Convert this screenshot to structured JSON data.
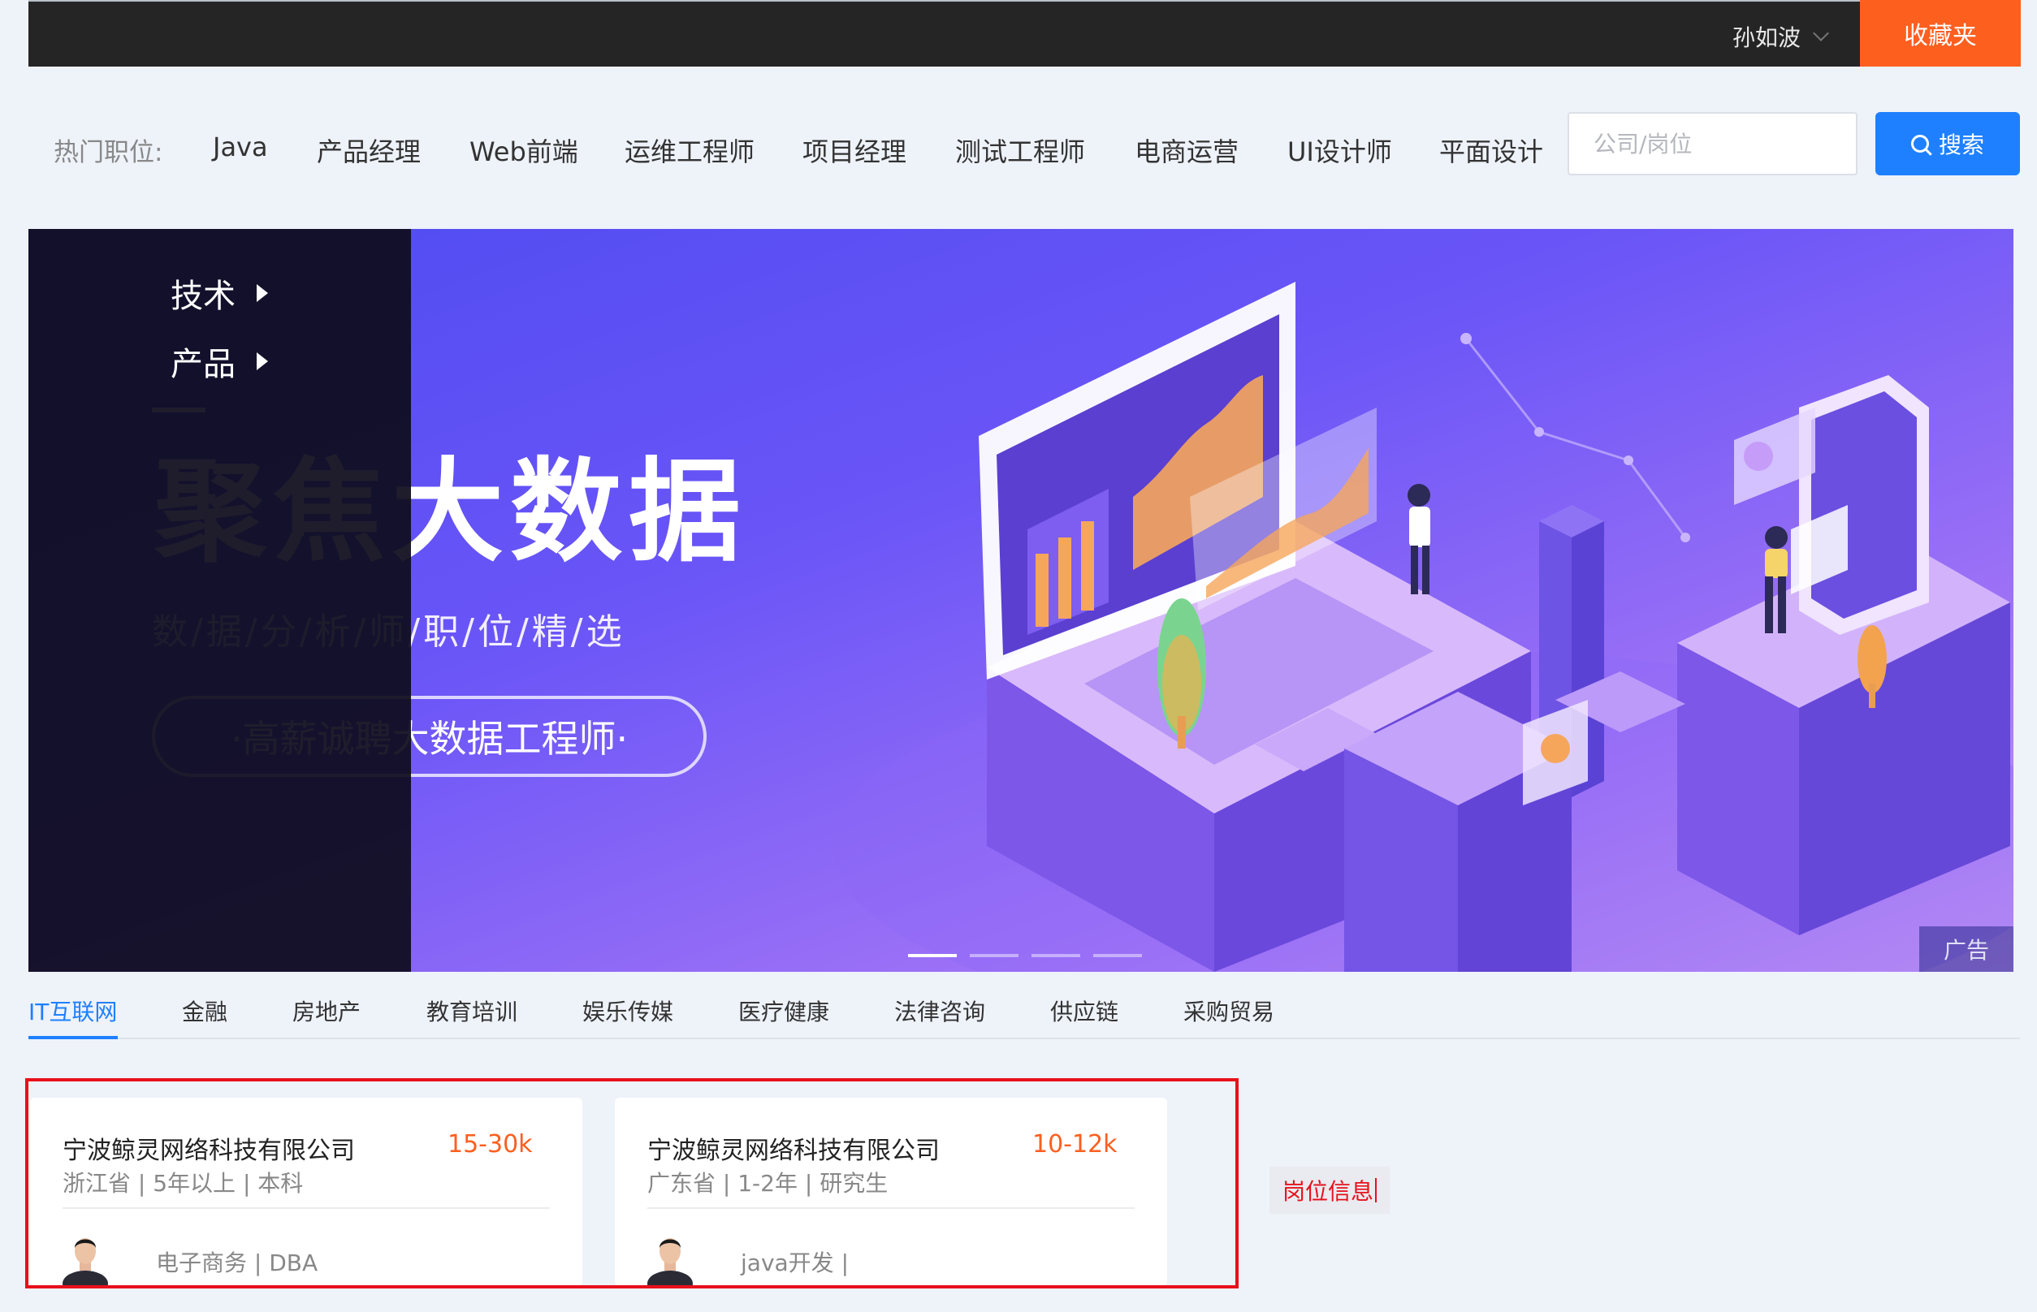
{
  "topbar": {
    "user_name": "孙如波",
    "favorites_label": "收藏夹"
  },
  "hot_jobs": {
    "label": "热门职位:",
    "items": [
      "Java",
      "产品经理",
      "Web前端",
      "运维工程师",
      "项目经理",
      "测试工程师",
      "电商运营",
      "UI设计师",
      "平面设计"
    ]
  },
  "search": {
    "placeholder": "公司/岗位",
    "value": "",
    "button_label": "搜索"
  },
  "category_menu": {
    "items": [
      "技术",
      "产品"
    ]
  },
  "banner": {
    "headline": "聚焦大数据",
    "subtitle": "数/据/分/析/师/职/位/精/选",
    "pill": "·高薪诚聘大数据工程师·",
    "ad_label": "广告",
    "slide_count": 4,
    "active_slide": 1
  },
  "industry_tabs": {
    "items": [
      "IT互联网",
      "金融",
      "房地产",
      "教育培训",
      "娱乐传媒",
      "医疗健康",
      "法律咨询",
      "供应链",
      "采购贸易"
    ],
    "active": "IT互联网"
  },
  "jobs": [
    {
      "company": "宁波鲸灵网络科技有限公司",
      "salary": "15-30k",
      "meta": "浙江省  |  5年以上  |  本科",
      "tags": "电子商务  |  DBA"
    },
    {
      "company": "宁波鲸灵网络科技有限公司",
      "salary": "10-12k",
      "meta": "广东省  |  1-2年  |  研究生",
      "tags": "java开发  |"
    }
  ],
  "annotation": {
    "label": "岗位信息"
  },
  "colors": {
    "accent_blue": "#1e80ff",
    "accent_orange": "#fd5f1f",
    "annotation_red": "#e8101b",
    "topbar_bg": "#252526"
  }
}
